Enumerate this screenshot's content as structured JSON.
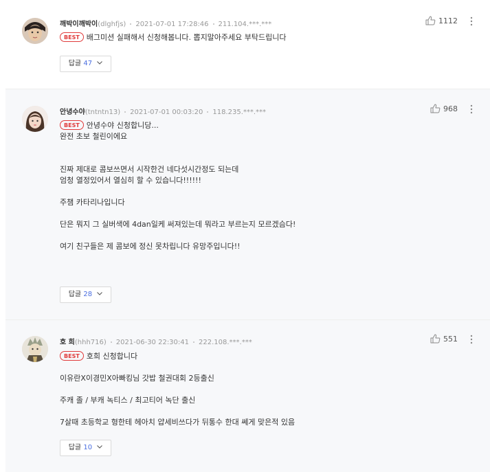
{
  "comments": [
    {
      "nickname": "깨박이깨박이",
      "user_id": "(dlghfjs)",
      "datetime": "2021-07-01 17:28:46",
      "ip": "211.104.***.***",
      "badge": "BEST",
      "lines": [
        "배그미션 실패해서 신청해봅니다. 뽑지말아주세요 부탁드립니다"
      ],
      "reply_label": "답글",
      "reply_count": "47",
      "likes": "1112"
    },
    {
      "nickname": "안녕수야",
      "user_id": "(tntntn13)",
      "datetime": "2021-07-01 00:03:20",
      "ip": "118.235.***.***",
      "badge": "BEST",
      "lines": [
        "안녕수야 신청합니당...",
        "완전 초보 철린이에요",
        "",
        "",
        "진짜 제대로 콤보쓰면서 시작한건 네다섯시간정도 되는데",
        "엄청 열정있어서 열심히 할 수 있습니다!!!!!!",
        "",
        "주챔 카타리나입니다",
        "",
        "단은 뭐지 그 실버색에 4dan일케 써져있는데 뭐라고 부르는지 모르겠슴다!",
        "",
        "여기 친구들은 제 콤보에 정신 못차립니다 유망주입니다!!"
      ],
      "reply_label": "답글",
      "reply_count": "28",
      "likes": "968"
    },
    {
      "nickname": "호 희",
      "user_id": "(hhh716)",
      "datetime": "2021-06-30 22:30:41",
      "ip": "222.108.***.***",
      "badge": "BEST",
      "lines": [
        "호희 신청합니다",
        "",
        "이유란X이경민X아빠킹님 갓밥 철권대회 2등출신",
        "",
        "주캐 졸 / 부캐 녹티스 / 최고티어 녹단 출신",
        "",
        "7살때 초등학교 형한테 헤아치 얍세비쓰다가 뒤통수 한대 쎄게 맞은적 있음"
      ],
      "reply_label": "답글",
      "reply_count": "10",
      "likes": "551"
    }
  ],
  "icons": {
    "like": "thumbs-up-icon",
    "more": "more-vertical-icon",
    "chevron": "chevron-down-icon"
  },
  "colors": {
    "badge": "#e03a3a",
    "reply_count": "#4a6ee0"
  }
}
